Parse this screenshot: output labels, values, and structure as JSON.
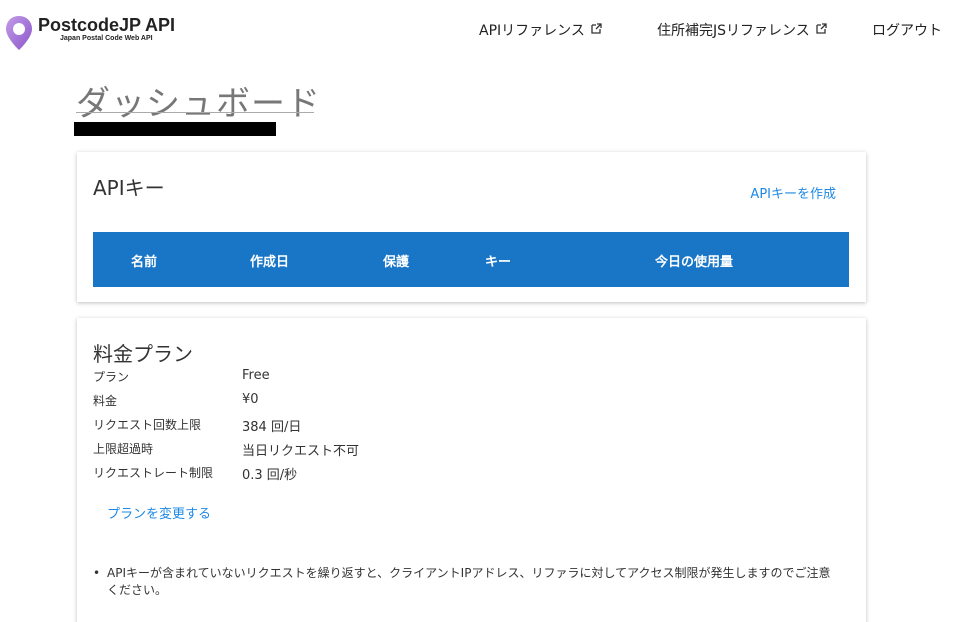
{
  "header": {
    "logo_title": "PostcodeJP API",
    "logo_subtitle": "Japan Postal Code Web API",
    "nav": [
      {
        "label": "APIリファレンス",
        "external": true
      },
      {
        "label": "住所補完JSリファレンス",
        "external": true
      },
      {
        "label": "ログアウト",
        "external": false
      }
    ]
  },
  "page": {
    "title": "ダッシュボード"
  },
  "api_card": {
    "title": "APIキー",
    "create_link": "APIキーを作成",
    "columns": [
      "名前",
      "作成日",
      "保護",
      "キー",
      "今日の使用量"
    ]
  },
  "plan_card": {
    "title": "料金プラン",
    "rows": [
      {
        "label": "プラン",
        "value": "Free"
      },
      {
        "label": "料金",
        "value": "¥0"
      },
      {
        "label": "リクエスト回数上限",
        "value": "384 回/日"
      },
      {
        "label": "上限超過時",
        "value": "当日リクエスト不可"
      },
      {
        "label": "リクエストレート制限",
        "value": "0.3 回/秒"
      }
    ],
    "change_link": "プランを変更する",
    "notes": [
      "APIキーが含まれていないリクエストを繰り返すと、クライアントIPアドレス、リファラに対してアクセス制限が発生しますのでご注意ください。"
    ]
  },
  "colors": {
    "accent": "#1976c7",
    "link": "#1e88e5",
    "logo_pin": "#a77bd8"
  }
}
